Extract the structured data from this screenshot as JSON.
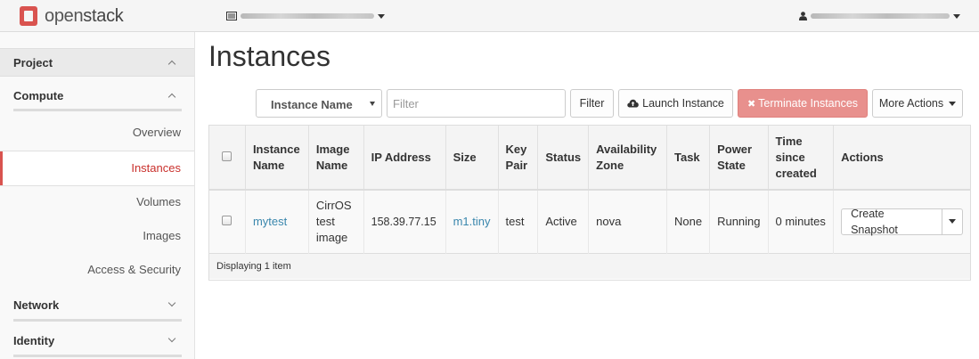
{
  "brand": {
    "name_part1": "open",
    "name_part2": "stack",
    "accent_color": "#d9534f"
  },
  "header": {
    "project_icon": "project-list-icon",
    "user_icon": "user-icon"
  },
  "sidebar": {
    "project_label": "Project",
    "compute_label": "Compute",
    "items": [
      {
        "label": "Overview",
        "active": false
      },
      {
        "label": "Instances",
        "active": true
      },
      {
        "label": "Volumes",
        "active": false
      },
      {
        "label": "Images",
        "active": false
      },
      {
        "label": "Access & Security",
        "active": false
      }
    ],
    "network_label": "Network",
    "identity_label": "Identity"
  },
  "page": {
    "title": "Instances"
  },
  "toolbar": {
    "filter_field_selected": "Instance Name",
    "filter_placeholder": "Filter",
    "filter_button": "Filter",
    "launch_button": "Launch Instance",
    "terminate_button": "Terminate Instances",
    "more_actions_button": "More Actions"
  },
  "table": {
    "columns": {
      "instance_name": [
        "Instance",
        "Name"
      ],
      "image_name": [
        "Image",
        "Name"
      ],
      "ip_address": "IP Address",
      "size": "Size",
      "key_pair": [
        "Key",
        "Pair"
      ],
      "status": "Status",
      "availability_zone": [
        "Availability",
        "Zone"
      ],
      "task": "Task",
      "power_state": [
        "Power",
        "State"
      ],
      "time_since_created": [
        "Time",
        "since",
        "created"
      ],
      "actions": "Actions"
    },
    "rows": [
      {
        "instance_name": "mytest",
        "image_name": [
          "CirrOS",
          "test",
          "image"
        ],
        "ip_address": "158.39.77.15",
        "size": "m1.tiny",
        "key_pair": "test",
        "status": "Active",
        "availability_zone": "nova",
        "task": "None",
        "power_state": "Running",
        "time_since_created": "0 minutes",
        "action_label": "Create Snapshot"
      }
    ],
    "footer": "Displaying 1 item"
  }
}
